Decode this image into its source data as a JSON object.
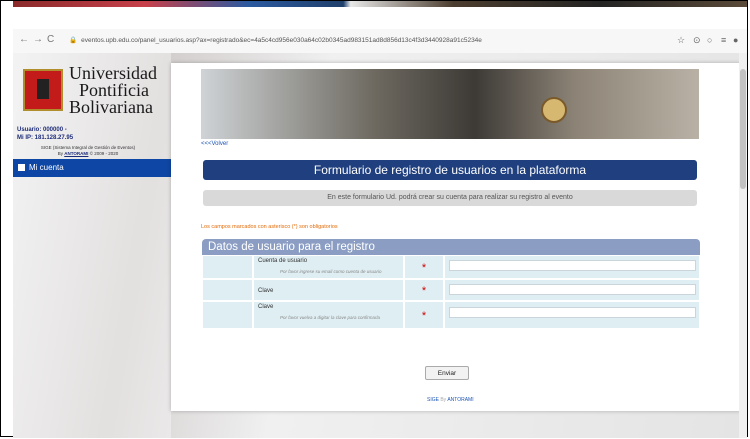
{
  "browser": {
    "url": "eventos.upb.edu.co/panel_usuarios.asp?ax=registrado&ec=4a5c4cd956e030a64c02b0345ad983151ad8d856d13c4f3d3440928a91c5234e",
    "back_icon": "arrow-left-icon",
    "forward_icon": "arrow-right-icon",
    "reload_icon": "reload-icon"
  },
  "sidebar": {
    "logo_line1": "Universidad",
    "logo_line2": "Pontificia",
    "logo_line3": "Bolivariana",
    "usuario": "Usuario: 000000 -",
    "ip": "Mi IP: 181.128.27.95",
    "sige_line1": "SIGE (Sistema Integral de Gestión de Eventos)",
    "sige_by": "By",
    "sige_author": "ANTORAMI",
    "sige_years": "© 2009 - 2020",
    "menu_label": "Mi cuenta"
  },
  "form": {
    "volver": "<<<Volver",
    "title": "Formulario de registro de usuarios en la plataforma",
    "info": "En este formulario Ud. podrá crear su cuenta para realizar su registro al evento",
    "required_note": "Los campos marcados con asterisco (*) son obligatorios",
    "section_title": "Datos de usuario para el registro",
    "fields": [
      {
        "label": "Cuenta de usuario",
        "hint": "Por favor ingrese su email como cuenta de usuario",
        "value": ""
      },
      {
        "label": "Clave",
        "hint": "",
        "value": ""
      },
      {
        "label": "Clave",
        "hint": "Por favor vuelva a digitar la clave para confirmarla",
        "value": ""
      }
    ],
    "asterisk": "*",
    "submit": "Enviar"
  },
  "footer": {
    "sige": "SIGE",
    "by": "By",
    "author": "ANTORAMI"
  },
  "colors": {
    "brand_blue": "#1f3f7e",
    "section_blue": "#8b9dc3",
    "note_orange": "#e36c09",
    "required_red": "#cc0000"
  }
}
